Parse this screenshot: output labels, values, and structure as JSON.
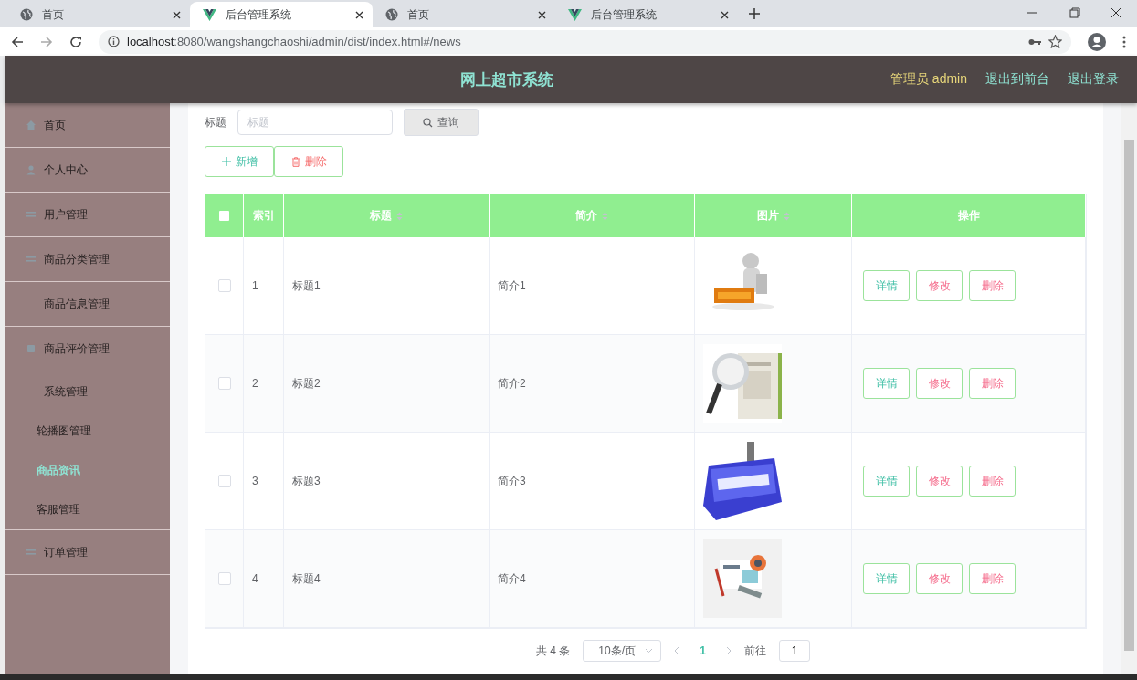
{
  "browser": {
    "tabs": [
      {
        "title": "首页",
        "selected": false
      },
      {
        "title": "后台管理系统",
        "selected": true
      },
      {
        "title": "首页",
        "selected": false
      },
      {
        "title": "后台管理系统",
        "selected": false
      }
    ],
    "url_host": "localhost",
    "url_rest": ":8080/wangshangchaoshi/admin/dist/index.html#/news"
  },
  "header": {
    "title": "网上超市系统",
    "user": "管理员 admin",
    "links": [
      "退出到前台",
      "退出登录"
    ]
  },
  "sidebar": {
    "items": [
      {
        "label": "首页",
        "selected": false
      },
      {
        "label": "个人中心",
        "selected": false
      },
      {
        "label": "用户管理",
        "selected": false
      },
      {
        "label": "商品分类管理",
        "selected": false
      },
      {
        "label": "商品信息管理",
        "selected": false
      },
      {
        "label": "商品评价管理",
        "selected": false
      },
      {
        "label": "系统管理",
        "selected": false,
        "expanded": true,
        "children": [
          {
            "label": "轮播图管理",
            "selected": false
          },
          {
            "label": "商品资讯",
            "selected": true
          },
          {
            "label": "客服管理",
            "selected": false
          }
        ]
      },
      {
        "label": "订单管理",
        "selected": false
      }
    ]
  },
  "search": {
    "label": "标题",
    "placeholder": "标题",
    "button": "查询"
  },
  "actions": [
    {
      "kind": "add",
      "label": "新增"
    },
    {
      "kind": "delete",
      "label": "删除"
    }
  ],
  "table": {
    "all_checked": false,
    "columns": [
      {
        "label": "索引",
        "sortable": false
      },
      {
        "label": "标题",
        "sortable": true
      },
      {
        "label": "简介",
        "sortable": true
      },
      {
        "label": "图片",
        "sortable": true
      },
      {
        "label": "操作",
        "sortable": false
      }
    ],
    "rows": [
      {
        "checked": false,
        "index": "1",
        "title": "标题1",
        "intro": "简介1",
        "buttons": [
          "详情",
          "修改",
          "删除"
        ]
      },
      {
        "checked": false,
        "index": "2",
        "title": "标题2",
        "intro": "简介2",
        "buttons": [
          "详情",
          "修改",
          "删除"
        ]
      },
      {
        "checked": false,
        "index": "3",
        "title": "标题3",
        "intro": "简介3",
        "buttons": [
          "详情",
          "修改",
          "删除"
        ]
      },
      {
        "checked": false,
        "index": "4",
        "title": "标题4",
        "intro": "简介4",
        "buttons": [
          "详情",
          "修改",
          "删除"
        ]
      }
    ]
  },
  "pagination": {
    "total": "共 4 条",
    "page_size": "10条/页",
    "pages": [
      {
        "label": "1",
        "selected": true
      }
    ],
    "goto_label": "前往",
    "goto_value": "1"
  }
}
